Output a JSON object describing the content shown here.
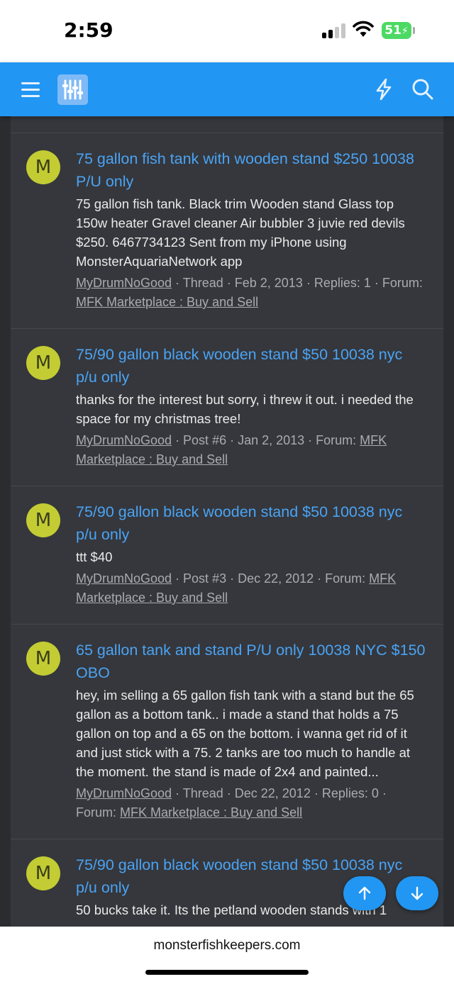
{
  "status_bar": {
    "time": "2:59",
    "battery": "51"
  },
  "header": {
    "menu_icon": "hamburger-menu-icon",
    "logo_icon": "sliders-logo-icon",
    "actions": [
      "bolt-icon",
      "search-icon"
    ],
    "background_color": "#2196f3"
  },
  "results": [
    {
      "avatar_letter": "M",
      "title": "75 gallon fish tank with wooden stand $250 10038 P/U only",
      "snippet": "75 gallon fish tank. Black trim Wooden stand Glass top 150w heater Gravel cleaner Air bubbler 3 juvie red devils $250. 6467734123 Sent from my iPhone using MonsterAquariaNetwork app",
      "author": "MyDrumNoGood",
      "meta": " · Thread · Feb 2, 2013 · Replies: 1 · Forum: ",
      "forum": "MFK Marketplace : Buy and Sell"
    },
    {
      "avatar_letter": "M",
      "title": "75/90 gallon black wooden stand $50 10038 nyc p/u only",
      "snippet": "thanks for the interest but sorry, i threw it out. i needed the space for my christmas tree!",
      "author": "MyDrumNoGood",
      "meta": " · Post #6 · Jan 2, 2013 · Forum: ",
      "forum": "MFK Marketplace : Buy and Sell"
    },
    {
      "avatar_letter": "M",
      "title": "75/90 gallon black wooden stand $50 10038 nyc p/u only",
      "snippet": "ttt $40",
      "author": "MyDrumNoGood",
      "meta": " · Post #3 · Dec 22, 2012 · Forum: ",
      "forum": "MFK Marketplace : Buy and Sell"
    },
    {
      "avatar_letter": "M",
      "title": "65 gallon tank and stand P/U only 10038 NYC $150 OBO",
      "snippet": "hey, im selling a 65 gallon fish tank with a stand but the 65 gallon as a bottom tank.. i made a stand that holds a 75 gallon on top and a 65 on the bottom. i wanna get rid of it and just stick with a 75. 2 tanks are too much to handle at the moment. the stand is made of 2x4 and painted...",
      "author": "MyDrumNoGood",
      "meta": " · Thread · Dec 22, 2012 · Replies: 0 · Forum: ",
      "forum": "MFK Marketplace : Buy and Sell"
    },
    {
      "avatar_letter": "M",
      "title": "75/90 gallon black wooden stand $50 10038 nyc p/u only",
      "snippet": "50 bucks take it. Its the petland wooden stands with 1",
      "author": "",
      "meta": "",
      "forum": ""
    }
  ],
  "scroll_buttons": [
    "arrow-up-icon",
    "arrow-down-icon"
  ],
  "bottom_bar": {
    "url": "monsterfishkeepers.com"
  }
}
